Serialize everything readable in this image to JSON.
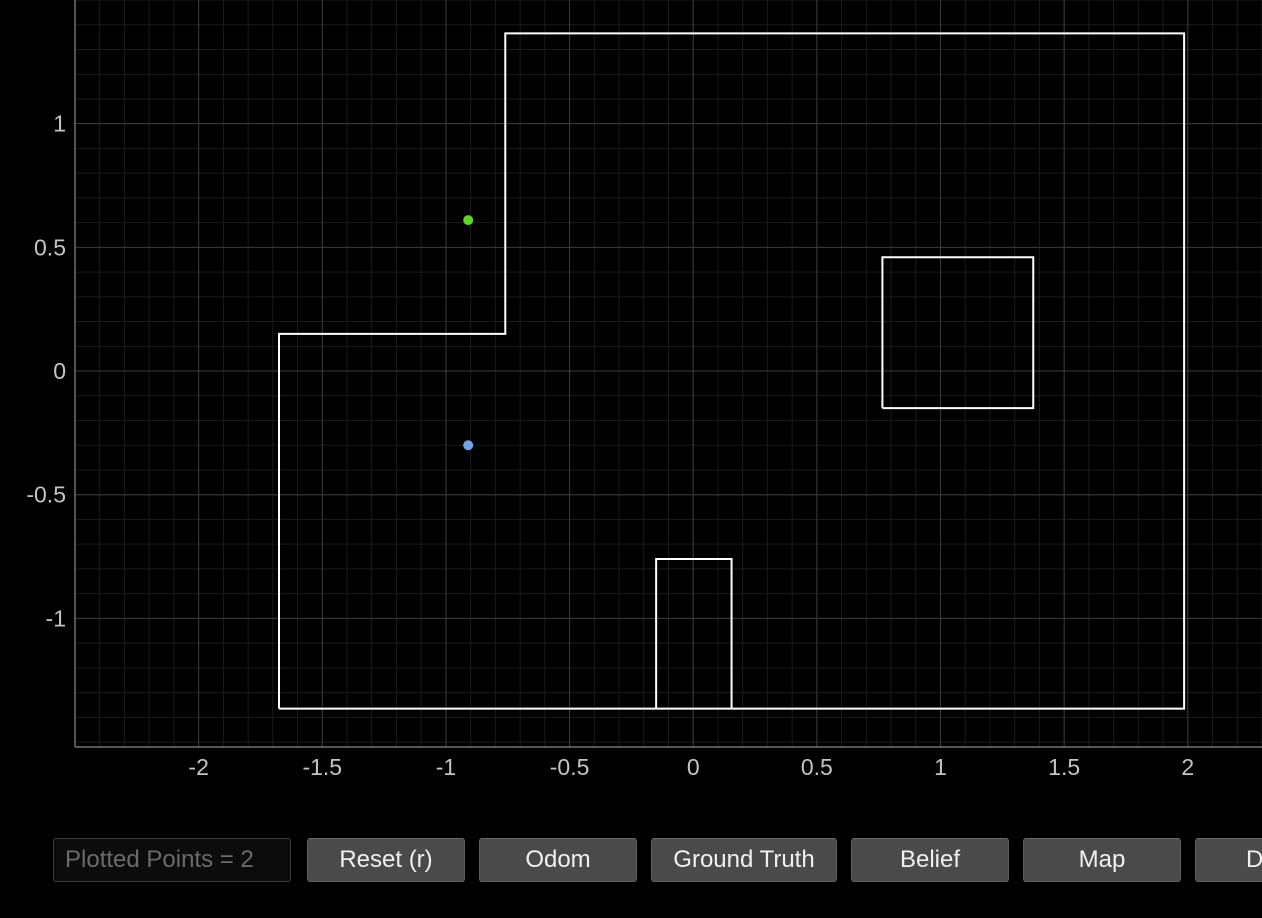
{
  "chart_data": {
    "type": "scatter",
    "xlim": [
      -2.5,
      2.3
    ],
    "ylim": [
      -1.52,
      1.5
    ],
    "x_ticks": [
      -2,
      -1.5,
      -1,
      -0.5,
      0,
      0.5,
      1,
      1.5,
      2
    ],
    "x_tick_labels": [
      "-2",
      "-1.5",
      "-1",
      "-0.5",
      "0",
      "0.5",
      "1",
      "1.5",
      "2"
    ],
    "y_ticks": [
      -1,
      -0.5,
      0,
      0.5,
      1
    ],
    "y_tick_labels": [
      "-1",
      "-0.5",
      "0",
      "0.5",
      "1"
    ],
    "grid": true,
    "series": [
      {
        "color": "#5cd61f",
        "points": [
          [
            -0.91,
            0.61
          ]
        ]
      },
      {
        "color": "#6ea5e8",
        "points": [
          [
            -0.91,
            -0.3
          ]
        ]
      }
    ],
    "map_lines": [
      [
        [
          -1.675,
          -1.365
        ],
        [
          1.985,
          -1.365
        ],
        [
          1.985,
          1.365
        ],
        [
          -0.76,
          1.365
        ],
        [
          -0.76,
          0.15
        ],
        [
          -1.675,
          0.15
        ],
        [
          -1.675,
          -1.365
        ]
      ],
      [
        [
          0.765,
          -0.15
        ],
        [
          1.375,
          -0.15
        ],
        [
          1.375,
          0.46
        ],
        [
          0.765,
          0.46
        ],
        [
          0.765,
          -0.15
        ]
      ],
      [
        [
          -0.15,
          -1.365
        ],
        [
          -0.15,
          -0.76
        ],
        [
          0.155,
          -0.76
        ],
        [
          0.155,
          -1.365
        ]
      ]
    ],
    "colors": {
      "map_line": "#ffffff",
      "grid_major": "#3a3a3a",
      "grid_minor": "#1b1b1b",
      "axis": "#8a8a8a"
    }
  },
  "toolbar": {
    "plotted_points": "Plotted Points = 2",
    "buttons": [
      "Reset (r)",
      "Odom",
      "Ground Truth",
      "Belief",
      "Map",
      "D"
    ]
  }
}
